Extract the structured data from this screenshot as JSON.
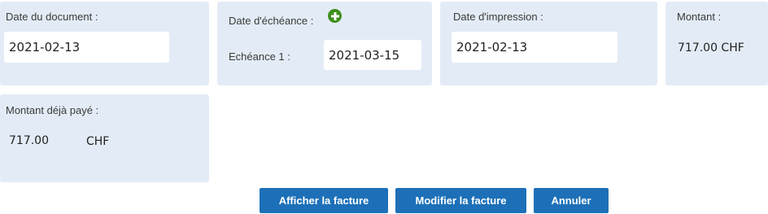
{
  "document_date": {
    "label": "Date du document :",
    "value": "2021-02-13"
  },
  "due_date": {
    "label": "Date d'échéance :",
    "add_icon": "plus-circle-icon",
    "installments": [
      {
        "label": "Echéance 1 :",
        "value": "2021-03-15"
      }
    ]
  },
  "print_date": {
    "label": "Date d'impression :",
    "value": "2021-02-13"
  },
  "amount": {
    "label": "Montant :",
    "value": "717.00 CHF"
  },
  "amount_paid": {
    "label": "Montant déjà payé :",
    "value": "717.00",
    "currency": "CHF"
  },
  "actions": {
    "show_invoice": "Afficher la facture",
    "edit_invoice": "Modifier la facture",
    "cancel": "Annuler"
  },
  "colors": {
    "card_background": "#e3ecf6",
    "button_primary": "#1d70b8",
    "add_icon": "#3f8f1e"
  }
}
